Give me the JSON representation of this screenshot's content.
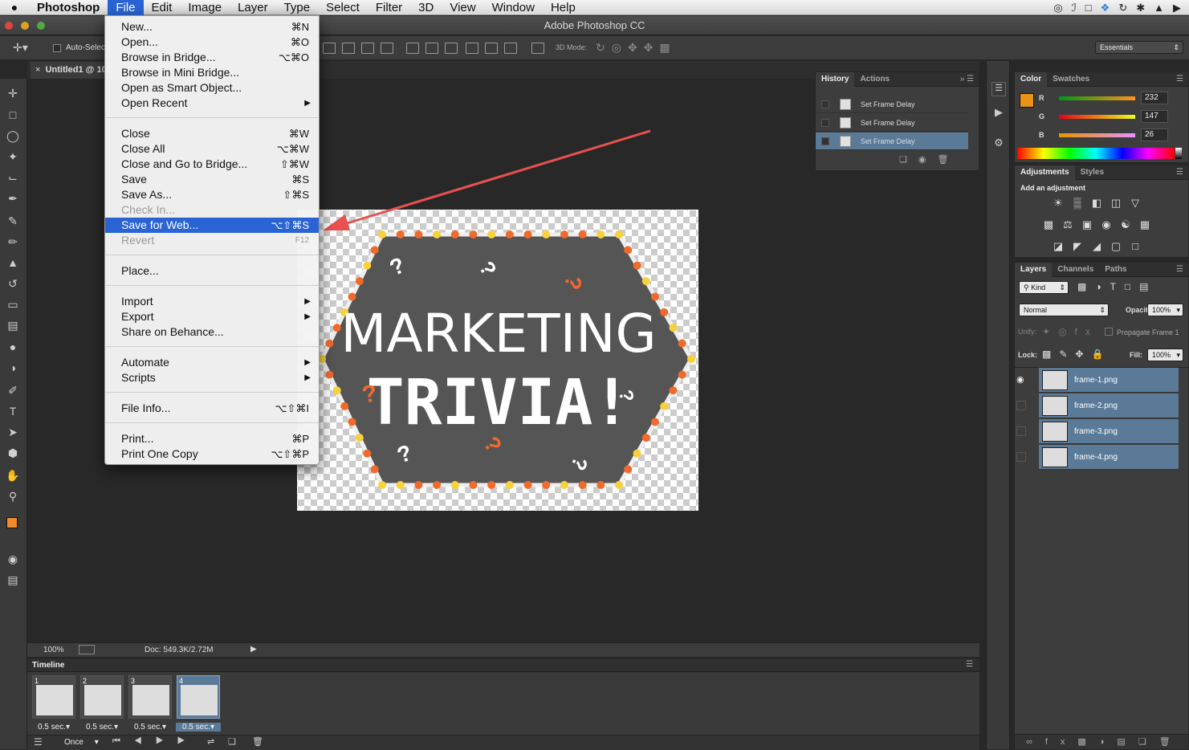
{
  "menubar": {
    "app": "Photoshop",
    "items": [
      "File",
      "Edit",
      "Image",
      "Layer",
      "Type",
      "Select",
      "Filter",
      "3D",
      "View",
      "Window",
      "Help"
    ]
  },
  "window": {
    "title": "Adobe Photoshop CC"
  },
  "options": {
    "auto_select": "Auto-Selec",
    "mode_label": "3D Mode:",
    "workspace": "Essentials"
  },
  "document": {
    "tab": "Untitled1 @ 10",
    "zoom": "100%",
    "doc_size": "Doc: 549.3K/2.72M"
  },
  "file_menu": {
    "items": [
      {
        "label": "New...",
        "shortcut": "⌘N"
      },
      {
        "label": "Open...",
        "shortcut": "⌘O"
      },
      {
        "label": "Browse in Bridge...",
        "shortcut": "⌥⌘O"
      },
      {
        "label": "Browse in Mini Bridge...",
        "shortcut": ""
      },
      {
        "label": "Open as Smart Object...",
        "shortcut": ""
      },
      {
        "label": "Open Recent",
        "shortcut": ""
      },
      {
        "label": "Close",
        "shortcut": "⌘W"
      },
      {
        "label": "Close All",
        "shortcut": "⌥⌘W"
      },
      {
        "label": "Close and Go to Bridge...",
        "shortcut": "⇧⌘W"
      },
      {
        "label": "Save",
        "shortcut": "⌘S"
      },
      {
        "label": "Save As...",
        "shortcut": "⇧⌘S"
      },
      {
        "label": "Check In...",
        "shortcut": ""
      },
      {
        "label": "Save for Web...",
        "shortcut": "⌥⇧⌘S"
      },
      {
        "label": "Revert",
        "shortcut": "F12"
      },
      {
        "label": "Place...",
        "shortcut": ""
      },
      {
        "label": "Import",
        "shortcut": ""
      },
      {
        "label": "Export",
        "shortcut": ""
      },
      {
        "label": "Share on Behance...",
        "shortcut": ""
      },
      {
        "label": "Automate",
        "shortcut": ""
      },
      {
        "label": "Scripts",
        "shortcut": ""
      },
      {
        "label": "File Info...",
        "shortcut": "⌥⇧⌘I"
      },
      {
        "label": "Print...",
        "shortcut": "⌘P"
      },
      {
        "label": "Print One Copy",
        "shortcut": "⌥⇧⌘P"
      }
    ]
  },
  "artwork": {
    "line1": "MARKETING",
    "line2": "TRIVIA!"
  },
  "history": {
    "tabs": [
      "History",
      "Actions"
    ],
    "rows": [
      "Set Frame Delay",
      "Set Frame Delay",
      "Set Frame Delay"
    ]
  },
  "color": {
    "tabs": [
      "Color",
      "Swatches"
    ],
    "r": "232",
    "g": "147",
    "b": "26",
    "r_label": "R",
    "g_label": "G",
    "b_label": "B",
    "swatch_hex": "#e8931a"
  },
  "adjustments": {
    "tabs": [
      "Adjustments",
      "Styles"
    ],
    "heading": "Add an adjustment"
  },
  "layers": {
    "tabs": [
      "Layers",
      "Channels",
      "Paths"
    ],
    "kind": "Kind",
    "blend": "Normal",
    "opacity_label": "Opacity:",
    "opacity": "100%",
    "unify_label": "Unify:",
    "propagate": "Propagate Frame 1",
    "lock_label": "Lock:",
    "fill_label": "Fill:",
    "fill": "100%",
    "items": [
      "frame-1.png",
      "frame-2.png",
      "frame-3.png",
      "frame-4.png"
    ]
  },
  "timeline": {
    "title": "Timeline",
    "frames": [
      {
        "num": "1",
        "delay": "0.5 sec."
      },
      {
        "num": "2",
        "delay": "0.5 sec."
      },
      {
        "num": "3",
        "delay": "0.5 sec."
      },
      {
        "num": "4",
        "delay": "0.5 sec."
      }
    ],
    "loop": "Once"
  },
  "colors": {
    "accent_orange": "#e8931a",
    "highlight_blue": "#2a64d4",
    "arrow_red": "#e8514f"
  }
}
